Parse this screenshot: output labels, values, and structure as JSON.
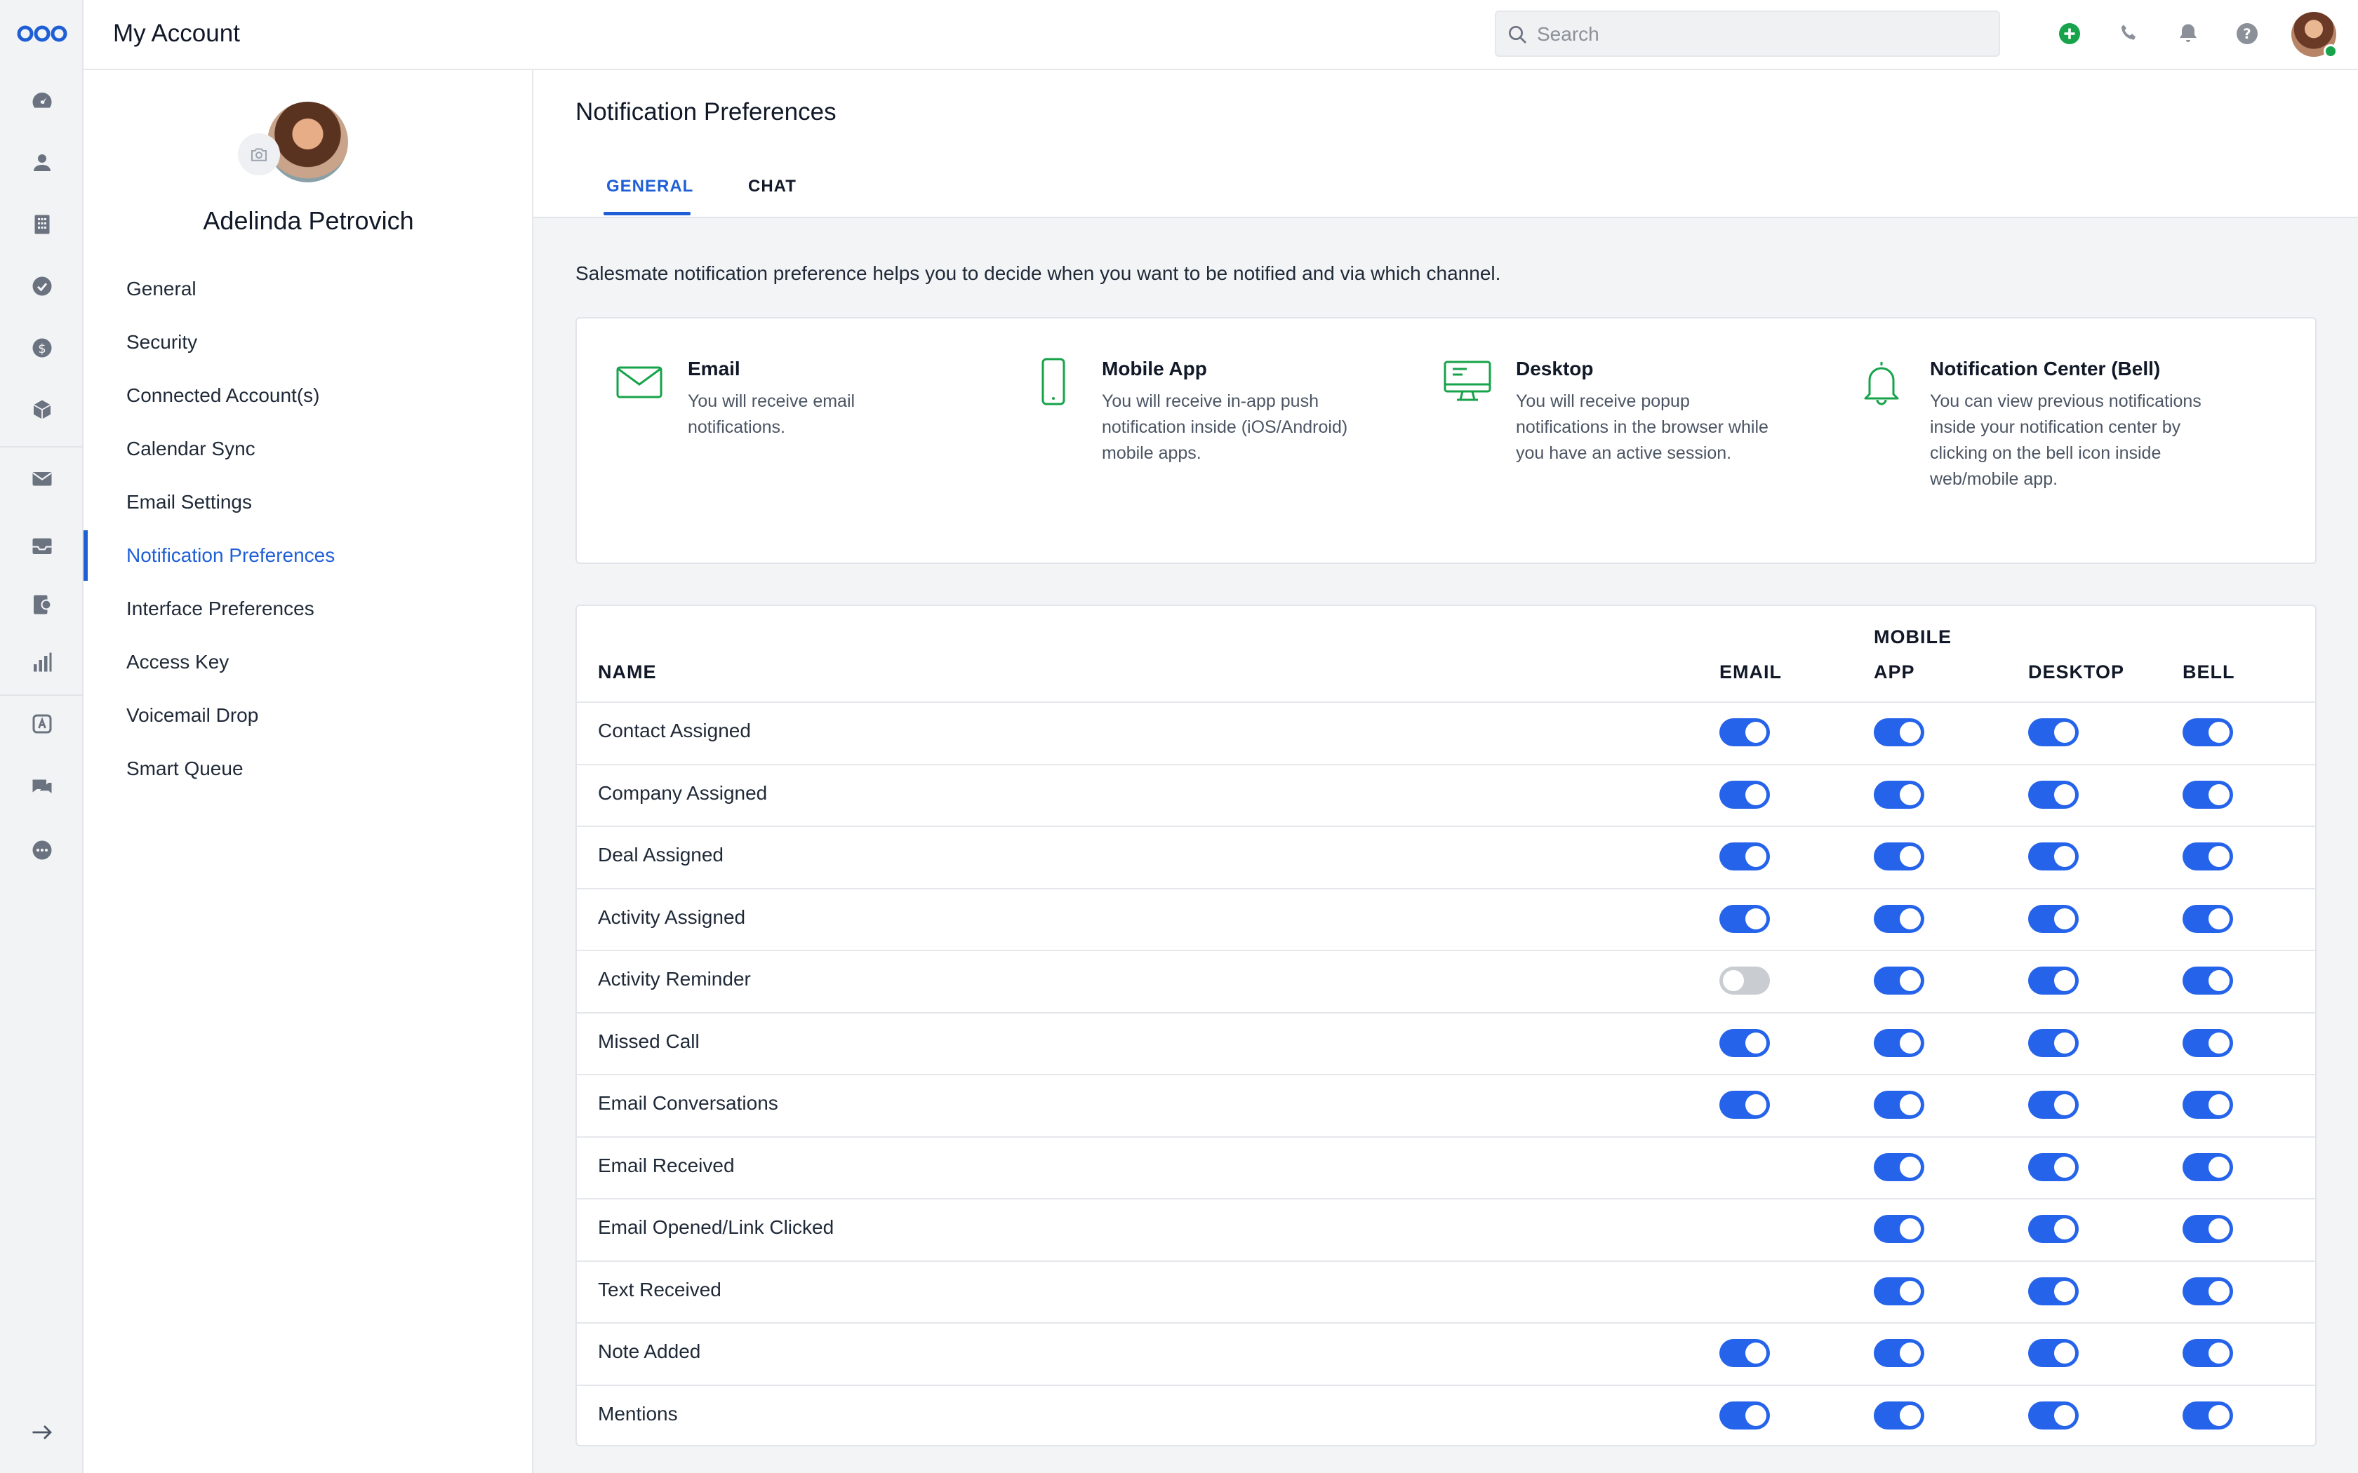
{
  "app": {
    "title": "My Account",
    "search_placeholder": "Search"
  },
  "colors": {
    "accent": "#1f5fd6",
    "toggle_on": "#2563eb",
    "toggle_off": "#c9ccd1",
    "card_icon": "#16a34a"
  },
  "rail_icons": [
    "dashboard-icon",
    "contacts-icon",
    "companies-icon",
    "tasks-icon",
    "deals-icon",
    "products-icon",
    "email-icon",
    "inbox-icon",
    "sequences-icon",
    "reports-icon",
    "automation-icon",
    "chat-icon",
    "more-icon",
    "expand-icon"
  ],
  "topbar_icons": [
    "add-icon",
    "phone-icon",
    "bell-icon",
    "help-icon"
  ],
  "profile": {
    "name": "Adelinda Petrovich"
  },
  "menu": [
    {
      "label": "General",
      "active": false
    },
    {
      "label": "Security",
      "active": false
    },
    {
      "label": "Connected Account(s)",
      "active": false
    },
    {
      "label": "Calendar Sync",
      "active": false
    },
    {
      "label": "Email Settings",
      "active": false
    },
    {
      "label": "Notification Preferences",
      "active": true
    },
    {
      "label": "Interface Preferences",
      "active": false
    },
    {
      "label": "Access Key",
      "active": false
    },
    {
      "label": "Voicemail Drop",
      "active": false
    },
    {
      "label": "Smart Queue",
      "active": false
    }
  ],
  "page": {
    "title": "Notification Preferences",
    "tabs": [
      {
        "label": "GENERAL",
        "active": true
      },
      {
        "label": "CHAT",
        "active": false
      }
    ],
    "intro": "Salesmate notification preference helps you to decide when you want to be notified and via which channel."
  },
  "channels": [
    {
      "icon": "envelope-icon",
      "title": "Email",
      "desc": "You will receive email notifications."
    },
    {
      "icon": "mobile-phone-icon",
      "title": "Mobile App",
      "desc": "You will receive in-app push notification inside (iOS/Android) mobile apps."
    },
    {
      "icon": "desktop-icon",
      "title": "Desktop",
      "desc": "You will receive popup notifications in the browser while you have an active session."
    },
    {
      "icon": "bell-outline-icon",
      "title": "Notification Center (Bell)",
      "desc": "You can view previous notifications inside your notification center by clicking on the bell icon inside web/mobile app."
    }
  ],
  "table": {
    "headers": {
      "name": "NAME",
      "email": "EMAIL",
      "mobile_1": "MOBILE",
      "mobile_2": "APP",
      "desktop": "DESKTOP",
      "bell": "BELL"
    },
    "rows": [
      {
        "name": "Contact Assigned",
        "email": true,
        "mobile": true,
        "desktop": true,
        "bell": true
      },
      {
        "name": "Company Assigned",
        "email": true,
        "mobile": true,
        "desktop": true,
        "bell": true
      },
      {
        "name": "Deal Assigned",
        "email": true,
        "mobile": true,
        "desktop": true,
        "bell": true
      },
      {
        "name": "Activity Assigned",
        "email": true,
        "mobile": true,
        "desktop": true,
        "bell": true
      },
      {
        "name": "Activity Reminder",
        "email": false,
        "mobile": true,
        "desktop": true,
        "bell": true
      },
      {
        "name": "Missed Call",
        "email": true,
        "mobile": true,
        "desktop": true,
        "bell": true
      },
      {
        "name": "Email Conversations",
        "email": true,
        "mobile": true,
        "desktop": true,
        "bell": true
      },
      {
        "name": "Email Received",
        "email": null,
        "mobile": true,
        "desktop": true,
        "bell": true
      },
      {
        "name": "Email Opened/Link Clicked",
        "email": null,
        "mobile": true,
        "desktop": true,
        "bell": true
      },
      {
        "name": "Text Received",
        "email": null,
        "mobile": true,
        "desktop": true,
        "bell": true
      },
      {
        "name": "Note Added",
        "email": true,
        "mobile": true,
        "desktop": true,
        "bell": true
      },
      {
        "name": "Mentions",
        "email": true,
        "mobile": true,
        "desktop": true,
        "bell": true
      }
    ]
  }
}
